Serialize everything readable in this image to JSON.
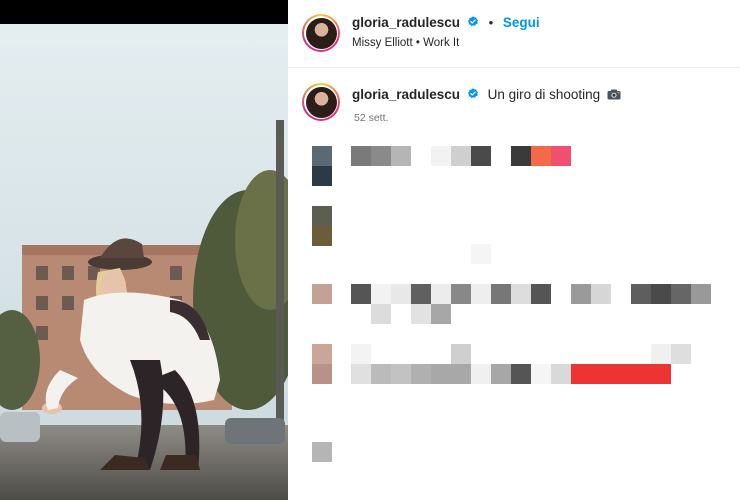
{
  "post": {
    "author": {
      "username": "gloria_radulescu",
      "verified": true
    },
    "follow_label": "Segui",
    "separator": "•",
    "audio": "Missy Elliott • Work It",
    "caption": {
      "username": "gloria_radulescu",
      "text": "Un giro di shooting",
      "emoji_icon": "camera-icon",
      "time_ago": "52 sett."
    }
  },
  "colors": {
    "accent": "#0095f6",
    "text": "#262626",
    "muted": "#737373",
    "verified": "#0095f6"
  },
  "redacted_comments": [
    {
      "avatar_colors": [
        "#5a6a72",
        "#2b3a44"
      ],
      "rows": [
        [
          "#7a7a7a",
          "#8a8a8a",
          "#b5b5b5",
          "",
          "#f2f2f2",
          "#cfcfcf",
          "#4a4a4a",
          "",
          "#3a3a3a",
          "#f26a4a",
          "#f0506e"
        ]
      ]
    },
    {
      "avatar_colors": [
        "#5c5e52",
        "#6b5c3a"
      ],
      "rows": [
        [
          "",
          "",
          "",
          "#f5f5f5"
        ]
      ]
    },
    {
      "avatar_colors": [
        "#c4a195"
      ],
      "rows": [
        [
          "#555555",
          "#f2f2f2",
          "#e8e8e8",
          "#606060",
          "#ececec",
          "#888888",
          "#eeeeee",
          "#777777",
          "#dddddd",
          "#555555",
          "",
          "#9a9a9a",
          "#d6d6d6",
          "",
          "#5e5e5e",
          "#4a4a4a",
          "#666666",
          "#999999"
        ],
        [
          "",
          "#dcdcdc",
          "",
          "#e2e2e2",
          "#a7a7a7"
        ]
      ]
    },
    {
      "avatar_colors": [
        "#c9a59a",
        "#b8928a"
      ],
      "rows": [
        [
          "#f3f3f3",
          "",
          "",
          "",
          "",
          "#cfcfcf",
          "",
          "",
          "",
          "",
          "",
          "",
          "",
          "",
          "",
          "#f0f0f0",
          "#dedede"
        ],
        [
          "#e0e0e0",
          "#bbbbbb",
          "#c2c2c2",
          "#b0b0b0",
          "#a8a8a8",
          "#a8a8a8",
          "#f0f0f0",
          "#a7a7a7",
          "#555555",
          "#f5f5f5",
          "#d9d9d9",
          "#ee3333",
          "#ee3333",
          "#ee3333",
          "#ee3333",
          "#ee3333"
        ]
      ]
    },
    {
      "avatar_colors": [
        "#b5b5b5"
      ],
      "rows": []
    }
  ]
}
